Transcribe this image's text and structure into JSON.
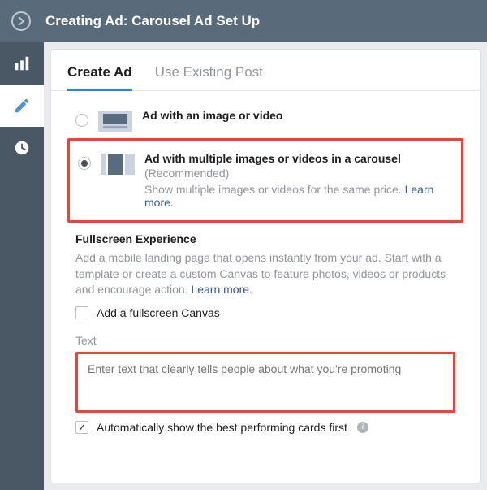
{
  "header": {
    "title": "Creating Ad: Carousel Ad Set Up"
  },
  "sidebar": {
    "items": [
      {
        "name": "chart"
      },
      {
        "name": "pencil"
      },
      {
        "name": "clock"
      }
    ]
  },
  "tabs": {
    "create": "Create Ad",
    "existing": "Use Existing Post"
  },
  "options": {
    "single": {
      "title": "Ad with an image or video"
    },
    "carousel": {
      "title": "Ad with multiple images or videos in a carousel",
      "subtitle": "(Recommended)",
      "desc": "Show multiple images or videos for the same price. ",
      "learn_more": "Learn more."
    }
  },
  "fullscreen": {
    "heading": "Fullscreen Experience",
    "desc": "Add a mobile landing page that opens instantly from your ad. Start with a template or create a custom Canvas to feature photos, videos or products and encourage action. ",
    "learn_more": "Learn more.",
    "checkbox_label": "Add a fullscreen Canvas"
  },
  "text_section": {
    "label": "Text",
    "placeholder": "Enter text that clearly tells people about what you're promoting"
  },
  "auto_cards": {
    "label": "Automatically show the best performing cards first"
  }
}
